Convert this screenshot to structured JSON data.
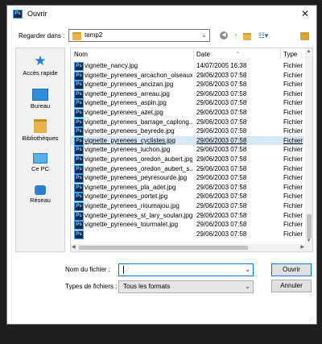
{
  "window": {
    "title": "Ouvrir",
    "app_icon": "Ps",
    "close_symbol": "✕"
  },
  "toolbar": {
    "look_in_label": "Regarder dans :",
    "look_in_value": "temp2"
  },
  "places": [
    {
      "label": "Accès rapide",
      "icon": "star-icon"
    },
    {
      "label": "Bureau",
      "icon": "desktop-icon"
    },
    {
      "label": "Bibliothèques",
      "icon": "libraries-icon"
    },
    {
      "label": "Ce PC",
      "icon": "computer-icon"
    },
    {
      "label": "Réseau",
      "icon": "network-icon"
    }
  ],
  "columns": {
    "name": "Nom",
    "date": "Date",
    "type": "Type"
  },
  "files": [
    {
      "name": "vignette_nancy.jpg",
      "date": "14/07/2005 16:38",
      "type": "Fichier"
    },
    {
      "name": "vignette_pyrenees_arcachon_oiseaux.jpg",
      "date": "29/06/2003 07:58",
      "type": "Fichier"
    },
    {
      "name": "vignette_pyrenees_ancizan.jpg",
      "date": "29/06/2003 07:58",
      "type": "Fichier"
    },
    {
      "name": "vignette_pyrenees_arreau.jpg",
      "date": "29/06/2003 07:58",
      "type": "Fichier"
    },
    {
      "name": "vignette_pyrenees_aspin.jpg",
      "date": "29/06/2003 07:58",
      "type": "Fichier"
    },
    {
      "name": "vignette_pyrenees_azet.jpg",
      "date": "29/06/2003 07:58",
      "type": "Fichier"
    },
    {
      "name": "vignette_pyrenees_barrage_caplong...",
      "date": "29/06/2003 07:58",
      "type": "Fichier"
    },
    {
      "name": "vignette_pyrenees_beyrede.jpg",
      "date": "29/06/2003 07:58",
      "type": "Fichier"
    },
    {
      "name": "vignette_pyrenees_cyclistes.jpg",
      "date": "29/06/2003 07:58",
      "type": "Fichier"
    },
    {
      "name": "vignette_pyrenees_luchon.jpg",
      "date": "29/06/2003 07:58",
      "type": "Fichier"
    },
    {
      "name": "vignette_pyrenees_oredon_aubert.jpg",
      "date": "29/06/2003 07:58",
      "type": "Fichier"
    },
    {
      "name": "vignette_pyrenees_oredon_aubert_s...",
      "date": "29/06/2003 07:58",
      "type": "Fichier"
    },
    {
      "name": "vignette_pyrenees_peyresourde.jpg",
      "date": "29/06/2003 07:58",
      "type": "Fichier"
    },
    {
      "name": "vignette_pyrenees_pla_adet.jpg",
      "date": "29/06/2003 07:58",
      "type": "Fichier"
    },
    {
      "name": "vignette_pyrenees_portet.jpg",
      "date": "29/06/2003 07:58",
      "type": "Fichier"
    },
    {
      "name": "vignette_pyrenees_rioumajou.jpg",
      "date": "29/06/2003 07:58",
      "type": "Fichier"
    },
    {
      "name": "vignette_pyrenees_st_lary_soulan.jpg",
      "date": "29/06/2003 07:58",
      "type": "Fichier"
    },
    {
      "name": "vignette_pyrenees_tourmalet.jpg",
      "date": "29/06/2003 07:58",
      "type": "Fichier"
    },
    {
      "name": "",
      "date": "29/06/2003 07:58",
      "type": "Fichier"
    }
  ],
  "selected_file_index": 8,
  "bottom": {
    "filename_label": "Nom du fichier :",
    "filename_value": "",
    "filetype_label": "Types de fichiers :",
    "filetype_value": "Tous les formats",
    "open_button": "Ouvrir",
    "cancel_button": "Annuler"
  },
  "colors": {
    "accent": "#0078d7",
    "selection": "#d9e8f7"
  }
}
